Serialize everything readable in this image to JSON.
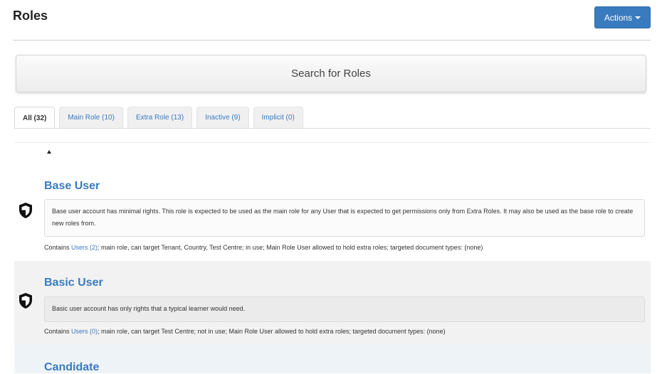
{
  "header": {
    "title": "Roles",
    "actions_label": "Actions"
  },
  "search": {
    "label": "Search for Roles"
  },
  "tabs": [
    {
      "label": "All (32)",
      "active": true
    },
    {
      "label": "Main Role (10)",
      "active": false
    },
    {
      "label": "Extra Role (13)",
      "active": false
    },
    {
      "label": "Inactive (9)",
      "active": false
    },
    {
      "label": "Implicit (0)",
      "active": false
    }
  ],
  "roles": [
    {
      "name": "Base User",
      "icon": "shield-icon",
      "description": "Base user account has minimal rights. This role is expected to be used as the main role for any User that is expected to get permissions only from Extra Roles. It may also be used as the base role to create new roles from.",
      "contains_prefix": "Contains ",
      "users_link": "Users (2)",
      "contains_suffix": "; main role, can target Tenant, Country, Test Centre; in use; Main Role User allowed to hold extra roles; targeted document types: (none)"
    },
    {
      "name": "Basic User",
      "icon": "shield-icon",
      "description": "Basic user account has only rights that a typical learner would need.",
      "contains_prefix": "Contains ",
      "users_link": "Users (0)",
      "contains_suffix": "; main role, can target Test Centre; not in use; Main Role User allowed to hold extra roles; targeted document types: (none)"
    },
    {
      "name": "Candidate"
    }
  ],
  "colors": {
    "accent": "#3a7bbf",
    "row_alt": "#f2f2f2",
    "row_highlight": "#eef3f8"
  }
}
